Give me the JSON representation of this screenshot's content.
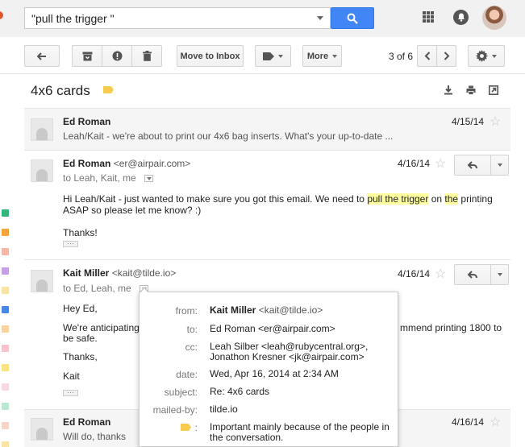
{
  "search": {
    "query": "\"pull the trigger \""
  },
  "toolbar": {
    "move_to_inbox": "Move to Inbox",
    "more": "More",
    "pager": "3 of 6"
  },
  "thread": {
    "subject": "4x6 cards",
    "label_color": "#f7cb4d"
  },
  "label_colors": [
    "#33b679",
    "#f6a33c",
    "#f4b7a8",
    "#c5a0e6",
    "#f9e3a5",
    "#4a86e8",
    "#fbd3a0",
    "#f6c2cc",
    "#fbe383",
    "#f7d8e3",
    "#b8e7d2",
    "#f6d5c8"
  ],
  "messages": [
    {
      "sender": "Ed Roman",
      "snippet": "Leah/Kait - we're about to print our 4x6 bag inserts. What's your up-to-date ...",
      "date": "4/15/14"
    },
    {
      "sender": "Ed Roman",
      "email": "<er@airpair.com>",
      "to": "to Leah, Kait, me",
      "date": "4/16/14",
      "body_pre": "Hi Leah/Kait - just wanted to make sure you got this email.  We need to ",
      "body_hl1": "pull the trigger",
      "body_mid": " on ",
      "body_hl2": "the",
      "body_post": " printing",
      "body_line2": "ASAP so please let me know? :)",
      "body_thanks": "Thanks!"
    },
    {
      "sender": "Kait Miller",
      "email": "<kait@tilde.io>",
      "to": "to Ed, Leah, me",
      "date": "4/16/14",
      "greeting": "Hey Ed,",
      "line1_start": "We're anticipating",
      "line1_end": "mmend printing 1800 to",
      "line2": "be safe.",
      "thanks": "Thanks,",
      "sign": "Kait"
    },
    {
      "sender": "Ed Roman",
      "snippet": "Will do, thanks",
      "date": "4/16/14"
    }
  ],
  "details": {
    "from_key": "from:",
    "from_name": "Kait Miller",
    "from_email": "<kait@tilde.io>",
    "to_key": "to:",
    "to_val": "Ed Roman <er@airpair.com>",
    "cc_key": "cc:",
    "cc_line1": "Leah Silber <leah@rubycentral.org>,",
    "cc_line2": "Jonathon Kresner <jk@airpair.com>",
    "date_key": "date:",
    "date_val": "Wed, Apr 16, 2014 at 2:34 AM",
    "subject_key": "subject:",
    "subject_val": "Re: 4x6 cards",
    "mailed_key": "mailed-by:",
    "mailed_val": "tilde.io",
    "importance_key": ":",
    "importance_line1": "Important mainly because of the people in",
    "importance_line2": "the conversation."
  }
}
